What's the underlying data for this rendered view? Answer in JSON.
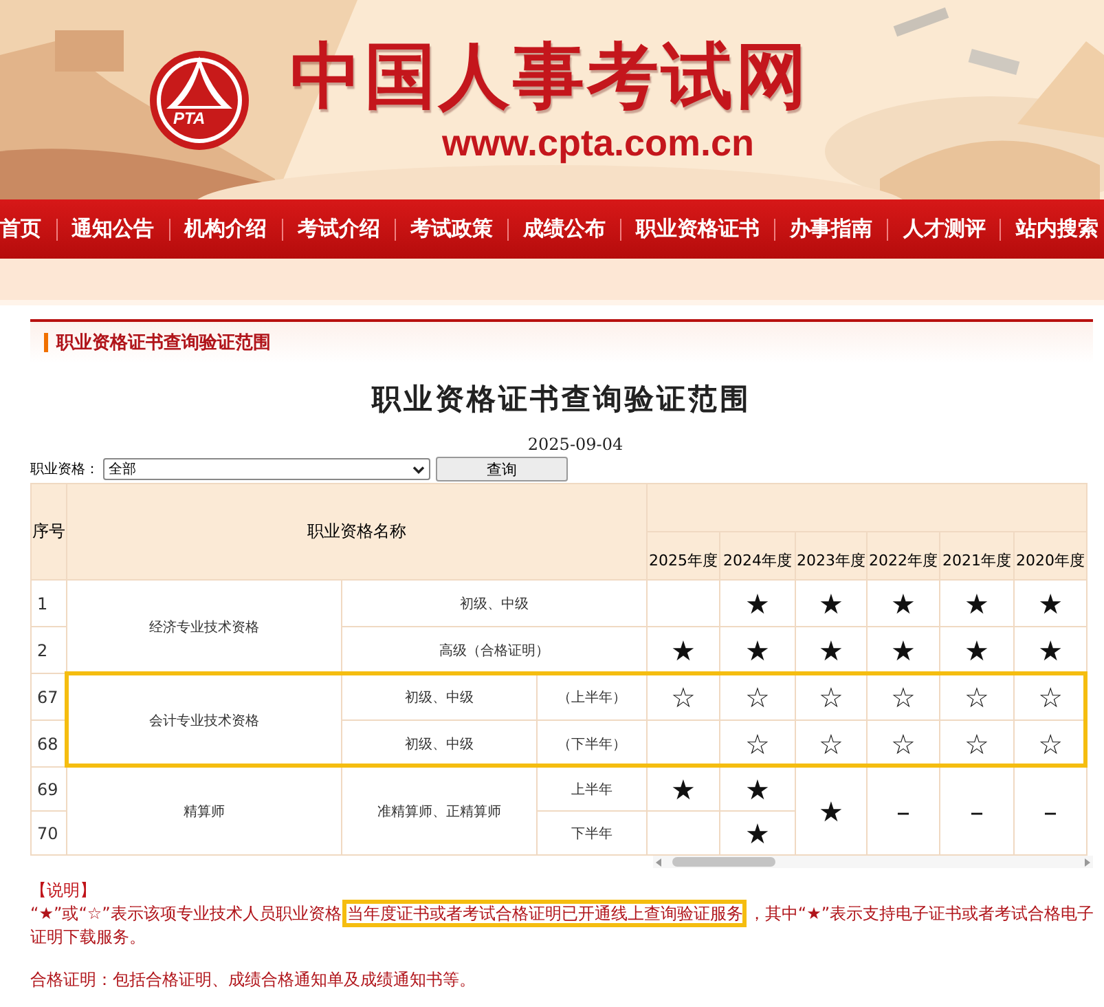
{
  "banner": {
    "logo_text": "PTA",
    "title": "中国人事考试网",
    "url": "www.cpta.com.cn"
  },
  "nav": [
    {
      "label": "首页"
    },
    {
      "label": "通知公告"
    },
    {
      "label": "机构介绍"
    },
    {
      "label": "考试介绍"
    },
    {
      "label": "考试政策"
    },
    {
      "label": "成绩公布"
    },
    {
      "label": "职业资格证书"
    },
    {
      "label": "办事指南"
    },
    {
      "label": "人才测评"
    },
    {
      "label": "站内搜索"
    }
  ],
  "section_title": "职业资格证书查询验证范围",
  "heading": "职业资格证书查询验证范围",
  "date": "2025-09-04",
  "filter": {
    "label": "职业资格：",
    "value": "全部",
    "button": "查询"
  },
  "table": {
    "columns": {
      "number": "序号",
      "name": "职业资格名称",
      "years": [
        "2025年度",
        "2024年度",
        "2023年度",
        "2022年度",
        "2021年度",
        "2020年度"
      ]
    },
    "rows": [
      {
        "highlighted": false,
        "cells": [
          {
            "kind": "number",
            "text": "1"
          },
          {
            "kind": "name",
            "text": "经济专业技术资格",
            "rowspan": 2
          },
          {
            "kind": "level",
            "text": "初级、中级",
            "colspan": 2
          },
          {
            "kind": "year"
          },
          {
            "kind": "year",
            "text": "★"
          },
          {
            "kind": "year",
            "text": "★"
          },
          {
            "kind": "year",
            "text": "★"
          },
          {
            "kind": "year",
            "text": "★"
          },
          {
            "kind": "year",
            "text": "★"
          }
        ]
      },
      {
        "highlighted": false,
        "cells": [
          {
            "kind": "number",
            "text": "2"
          },
          {
            "kind": "level",
            "text": "高级（合格证明）",
            "colspan": 2
          },
          {
            "kind": "year",
            "text": "★"
          },
          {
            "kind": "year",
            "text": "★"
          },
          {
            "kind": "year",
            "text": "★"
          },
          {
            "kind": "year",
            "text": "★"
          },
          {
            "kind": "year",
            "text": "★"
          },
          {
            "kind": "year",
            "text": "★"
          }
        ]
      },
      {
        "highlighted": true,
        "cells": [
          {
            "kind": "number",
            "text": "67"
          },
          {
            "kind": "name",
            "text": "会计专业技术资格",
            "rowspan": 2
          },
          {
            "kind": "level",
            "text": "初级、中级"
          },
          {
            "kind": "half",
            "text": "（上半年）"
          },
          {
            "kind": "year",
            "text": "☆"
          },
          {
            "kind": "year",
            "text": "☆"
          },
          {
            "kind": "year",
            "text": "☆"
          },
          {
            "kind": "year",
            "text": "☆"
          },
          {
            "kind": "year",
            "text": "☆"
          },
          {
            "kind": "year",
            "text": "☆"
          }
        ]
      },
      {
        "highlighted": true,
        "cells": [
          {
            "kind": "number",
            "text": "68"
          },
          {
            "kind": "level",
            "text": "初级、中级"
          },
          {
            "kind": "half",
            "text": "（下半年）"
          },
          {
            "kind": "year"
          },
          {
            "kind": "year",
            "text": "☆"
          },
          {
            "kind": "year",
            "text": "☆"
          },
          {
            "kind": "year",
            "text": "☆"
          },
          {
            "kind": "year",
            "text": "☆"
          },
          {
            "kind": "year",
            "text": "☆"
          }
        ]
      },
      {
        "highlighted": false,
        "cells": [
          {
            "kind": "number",
            "text": "69"
          },
          {
            "kind": "name",
            "text": "精算师",
            "rowspan": 2
          },
          {
            "kind": "level",
            "text": "准精算师、正精算师",
            "rowspan": 2
          },
          {
            "kind": "half",
            "text": "上半年"
          },
          {
            "kind": "year",
            "text": "★"
          },
          {
            "kind": "year",
            "text": "★"
          },
          {
            "kind": "year",
            "text": "★",
            "rowspan": 2
          },
          {
            "kind": "year",
            "text": "–",
            "rowspan": 2
          },
          {
            "kind": "year",
            "text": "–",
            "rowspan": 2
          },
          {
            "kind": "year",
            "text": "–",
            "rowspan": 2
          }
        ]
      },
      {
        "highlighted": false,
        "cells": [
          {
            "kind": "number",
            "text": "70"
          },
          {
            "kind": "half",
            "text": "下半年"
          },
          {
            "kind": "year"
          },
          {
            "kind": "year",
            "text": "★"
          }
        ]
      }
    ]
  },
  "notes": {
    "title": "【说明】",
    "paragraph": [
      {
        "text": "“★”或“☆”表示该项专业技术人员职业资格",
        "highlighted": false
      },
      {
        "text": "当年度证书或者考试合格证明已开通线上查询验证服务",
        "highlighted": true
      },
      {
        "text": "，其中“★”表示支持电子证书或者考试合格电子证明下载服务。",
        "highlighted": false
      }
    ],
    "definition": "合格证明：包括合格证明、成绩合格通知单及成绩通知书等。"
  }
}
